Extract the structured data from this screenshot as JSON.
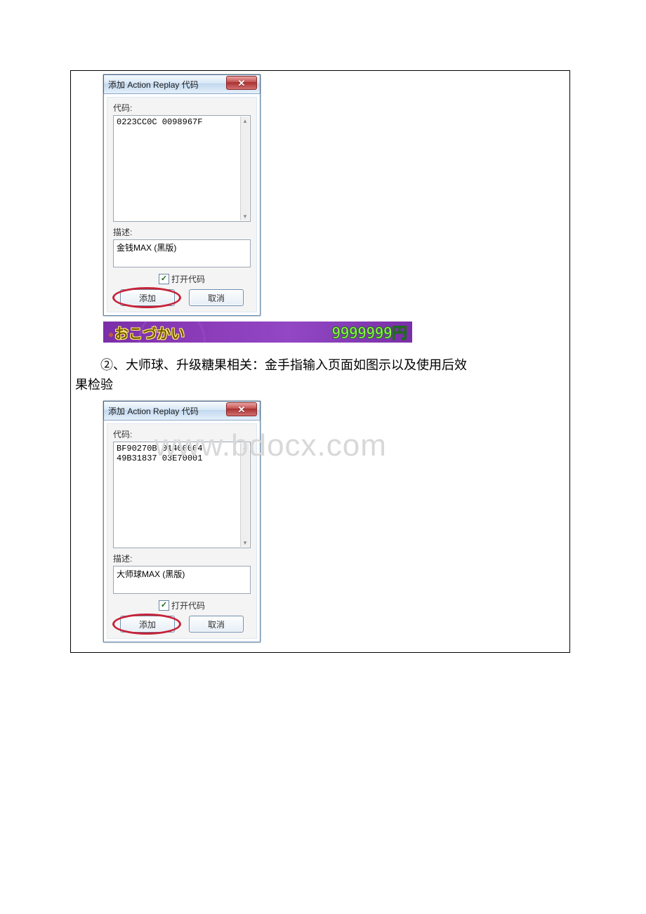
{
  "watermark": "www.bdocx.com",
  "dialog1": {
    "title": "添加 Action Replay 代码",
    "close_glyph": "✕",
    "code_label": "代码:",
    "code_value": "0223CC0C 0098967F",
    "desc_label": "描述:",
    "desc_value": "金钱MAX (黑版)",
    "open_code_label": "打开代码",
    "add_label": "添加",
    "cancel_label": "取消",
    "scroll_up": "▴",
    "scroll_down": "▾"
  },
  "banner": {
    "left": "おこづかい",
    "right": "9999999円"
  },
  "caption": {
    "line1": "②、大师球、升级糖果相关：金手指输入页面如图示以及使用后效",
    "line2": "果检验"
  },
  "dialog2": {
    "title": "添加 Action Replay 代码",
    "close_glyph": "✕",
    "code_label": "代码:",
    "code_value": "BF90270B 01400004\n49B31837 03E70001",
    "desc_label": "描述:",
    "desc_value": "大师球MAX (黑版)",
    "open_code_label": "打开代码",
    "add_label": "添加",
    "cancel_label": "取消",
    "scroll_up": "▴",
    "scroll_down": "▾"
  }
}
